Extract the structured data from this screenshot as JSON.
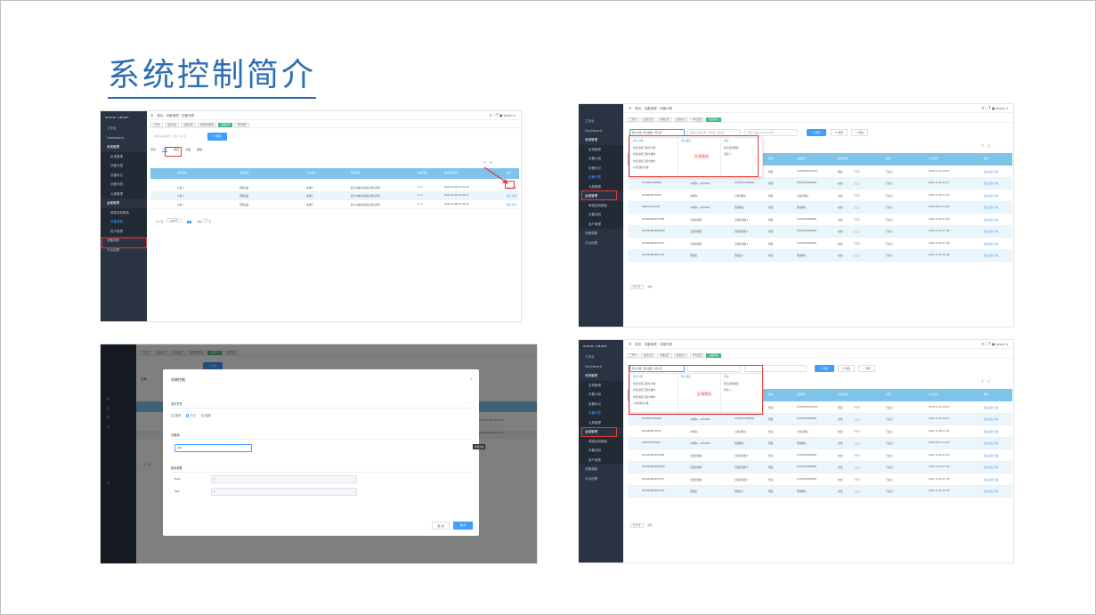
{
  "slide": {
    "title": "系统控制简介"
  },
  "app": {
    "logo": "SHICEI SMART",
    "breadcrumb": {
      "home": "首页",
      "parent": "设备管理",
      "current": "设备列表"
    },
    "user": "tester",
    "toolbar_icons": [
      "search-icon",
      "fullscreen-icon",
      "font-size-icon",
      "lock-icon"
    ]
  },
  "shot1": {
    "menu": [
      "工作台",
      "Dashboard",
      "系统管理",
      "区域管理",
      "设备分组",
      "设备标记",
      "设备列表",
      "大屏管理",
      "运维管理",
      "单路控制模板",
      "设备控制",
      "用户管理",
      "设备调度",
      "平台设置"
    ],
    "tags": [
      "工作台",
      "设备列表",
      "设备控制",
      "单路控制模板",
      "设备控制",
      "场景管理"
    ],
    "search_placeholder": "请输入设备编号、名称、UID等",
    "search_button": "搜索",
    "tabs": [
      "场景",
      "分组",
      "场景",
      "日程",
      "群组"
    ],
    "columns": [
      "通道名称",
      "设备类型",
      "开关状态",
      "控制区域",
      "设备回路",
      "最后操作时间",
      "操作"
    ],
    "rows": [
      [
        "分组 3",
        "照明设备",
        "未通行",
        "默认大楼/默认楼层/默认区域",
        "2 / 2",
        "2021-12-08 15:41:34",
        "修改 控制"
      ],
      [
        "分组 2",
        "照明设备",
        "未通行",
        "默认大楼/默认楼层/默认区域",
        "2 / 2",
        "2021-12-08 15:40:15",
        "修改 控制"
      ],
      [
        "分组 1",
        "照明设备",
        "未通行",
        "默认大楼/默认楼层/默认区域",
        "2 / 2",
        "2021-12-08 15:39:34",
        "修改 控制"
      ]
    ],
    "pagination": {
      "total": "共 3 条",
      "size": "10条/页",
      "page": "1",
      "goto": "前往",
      "goto_page": "1",
      "goto_suffix": "页"
    }
  },
  "shot2": {
    "menu": [
      "工作台",
      "Dashboard",
      "系统管理",
      "区域管理",
      "设备分组",
      "设备标记",
      "设备列表",
      "大屏管理",
      "运维管理",
      "单路控制模板",
      "设备控制",
      "用户管理",
      "设备调度",
      "平台设置"
    ],
    "tags": [
      "工作台",
      "设备分组",
      "单路设置",
      "设备标记",
      "单位设置",
      "设备列表"
    ],
    "cascade_value": "默认大楼 / 默认楼层 / 默认区",
    "filter_placeholders": [
      "请输入设备名称、IP等级、编号等",
      "请输入设备UID/MAC/IP等"
    ],
    "search_button": "搜索",
    "reset_button": "重置",
    "export_button": "导出",
    "dropdown": {
      "buildings": [
        "默认大楼",
        "约旦智能工程可大楼",
        "约旦智能工程大楼中",
        "约旦智能工程大楼中",
        "11区测试大楼"
      ],
      "floors": [
        "默认楼层"
      ],
      "areas": [
        "测试",
        "默认区域测区",
        "测试_1"
      ],
      "label": "区域筛选"
    },
    "columns": [
      "设备编号",
      "设备类型",
      "所属区域",
      "状态",
      "设备型号",
      "启用/禁用",
      "总数",
      "导入时间",
      "操作"
    ],
    "rows": [
      [
        "",
        "",
        "",
        "测试",
        "TCATRE4R3A0101",
        "测试",
        "已标记",
        "2018-11-21 19:57",
        "修改设备 详情"
      ],
      [
        "TCATR0C39BD06",
        "AC网关 - AKT9920",
        "TCATR0C39BD06",
        "测试",
        "TCATR0C39BD06",
        "在线",
        "已标记",
        "2021-11-22 10:17",
        "修改设备 详情"
      ],
      [
        "001982097T094",
        "LR网关",
        "小程序网关",
        "测试",
        "小程序网关",
        "在线",
        "已标记",
        "2021-11-06 11:35",
        "修改设备 详情"
      ],
      [
        "D6E224F7C6C4",
        "AC网关 - AKT9920",
        "测试网关",
        "测试",
        "测试网关",
        "在线",
        "已标记",
        "2021-09-17 11:05",
        "修改设备 详情"
      ],
      [
        "001982082DC7080",
        "包温控制器",
        "包温控制器 4",
        "测试",
        "TCATR0C39BD06",
        "在线",
        "已标记",
        "2021-12-03 11:09",
        "修改设备 详情"
      ],
      [
        "001982083C60DCB",
        "包温控制器",
        "包温控制器 3",
        "测试",
        "TCATR0C39BD06",
        "在线",
        "已标记",
        "2021-12-03 17:48",
        "修改设备 详情"
      ],
      [
        "001982082DC0707",
        "包温控制器",
        "包温控制器 2",
        "测试",
        "TCATR0C39BD06",
        "在线",
        "已标记",
        "2021-12-03 17:48",
        "修改设备 详情"
      ],
      [
        "001982083C6A703",
        "测温组",
        "测温组 1",
        "测试",
        "测试网关",
        "在线",
        "已标记",
        "2021-11-25 14:48",
        "修改设备 详情"
      ]
    ],
    "pagination": {
      "total": "共 8 条",
      "goto": "前往"
    }
  },
  "shot3": {
    "menu": [
      "",
      "",
      "",
      "",
      "区",
      "设",
      "设",
      "设",
      "",
      "",
      "",
      "",
      "",
      "设",
      "",
      "",
      "",
      ""
    ],
    "tags": [
      "工作台",
      "设备分组",
      "单路设置",
      "单路控制模板",
      "设备控制",
      "场景管理"
    ],
    "search_button": "搜索",
    "bg_rows": [
      "2021-12-08 15:41:34",
      "2021-12-08 15:40:15"
    ],
    "modal": {
      "title": "场景控制",
      "section_switch": "总灯开关",
      "radio_off": "关闭",
      "radio_on": "开启",
      "radio_keep": "保持",
      "section_brightness": "亮度值",
      "brightness_value": "240",
      "section_color": "颜色参数",
      "color_fields": [
        {
          "label": "Hue:",
          "value": "0"
        },
        {
          "label": "Sat:",
          "value": "0"
        }
      ],
      "cancel": "取 消",
      "confirm": "确 定",
      "tooltip": "控制亮度"
    },
    "pagination": {
      "total": "共 3 条"
    }
  },
  "shot4": {
    "menu": [
      "工作台",
      "Dashboard",
      "系统管理",
      "区域管理",
      "设备分组",
      "设备标记",
      "设备列表",
      "大屏管理",
      "运维管理",
      "单路控制模板",
      "设备控制",
      "用户管理",
      "设备调度",
      "平台设置"
    ],
    "tags": [
      "工作台",
      "设备分组",
      "单路设置",
      "设备标记",
      "单位设置",
      "设备列表"
    ],
    "cascade_value": "默认大楼 / 默认楼层 / 默认区",
    "search_button": "搜索",
    "reset_button": "重置",
    "export_button": "导出",
    "dropdown": {
      "buildings": [
        "默认大楼",
        "约旦智能工程可大楼",
        "约旦智能工程大楼中",
        "约旦智能工程大楼中",
        "11区测试大楼"
      ],
      "floors": [
        "默认楼层"
      ],
      "areas": [
        "测试",
        "默认区域测区",
        "测试_1"
      ],
      "label": "区域筛选"
    },
    "columns": [
      "设备编号",
      "设备类型",
      "所属区域",
      "状态",
      "设备型号",
      "启用/禁用",
      "总数",
      "导入时间",
      "操作"
    ],
    "rows": [
      [
        "",
        "",
        "",
        "测试",
        "TCATRE4R3A0101",
        "测试",
        "已标记",
        "2018-11-21 19:57",
        "修改设备 详情"
      ],
      [
        "TCATR0C39BD06",
        "AC网关 - AKT9920",
        "TCATR0C39BD06",
        "测试",
        "TCATR0C39BD06",
        "在线",
        "已标记",
        "2021-11-22 10:17",
        "修改设备 详情"
      ],
      [
        "001982097T094",
        "LR网关",
        "小程序网关",
        "测试",
        "小程序网关",
        "在线",
        "已标记",
        "2021-11-06 11:35",
        "修改设备 详情"
      ],
      [
        "D6E224F7C6C4",
        "AC网关 - AKT9920",
        "测试网关",
        "测试",
        "测试网关",
        "在线",
        "已标记",
        "2021-09-17 11:05",
        "修改设备 详情"
      ],
      [
        "001982082DC7080",
        "包温控制器",
        "包温控制器 4",
        "测试",
        "TCATR0C39BD06",
        "在线",
        "已标记",
        "2021-12-03 11:09",
        "修改设备 详情"
      ],
      [
        "001982083C60DCB",
        "包温控制器",
        "包温控制器 3",
        "测试",
        "TCATR0C39BD06",
        "在线",
        "已标记",
        "2021-12-03 17:48",
        "修改设备 详情"
      ],
      [
        "001982082DC0707",
        "包温控制器",
        "包温控制器 2",
        "测试",
        "TCATR0C39BD06",
        "在线",
        "已标记",
        "2021-12-03 17:48",
        "修改设备 详情"
      ],
      [
        "001982083C6A703",
        "测温组",
        "测温组 1",
        "测试",
        "测试网关",
        "在线",
        "已标记",
        "2021-11-25 14:48",
        "修改设备 详情"
      ]
    ],
    "pagination": {
      "total": "共 8 条",
      "goto": "前往"
    }
  },
  "colors": {
    "title": "#2d6db5",
    "sidebar": "#2a3342",
    "accent": "#409eff",
    "table_header": "#7ec3ea",
    "highlight": "#e53935",
    "tag_active": "#42b983"
  }
}
